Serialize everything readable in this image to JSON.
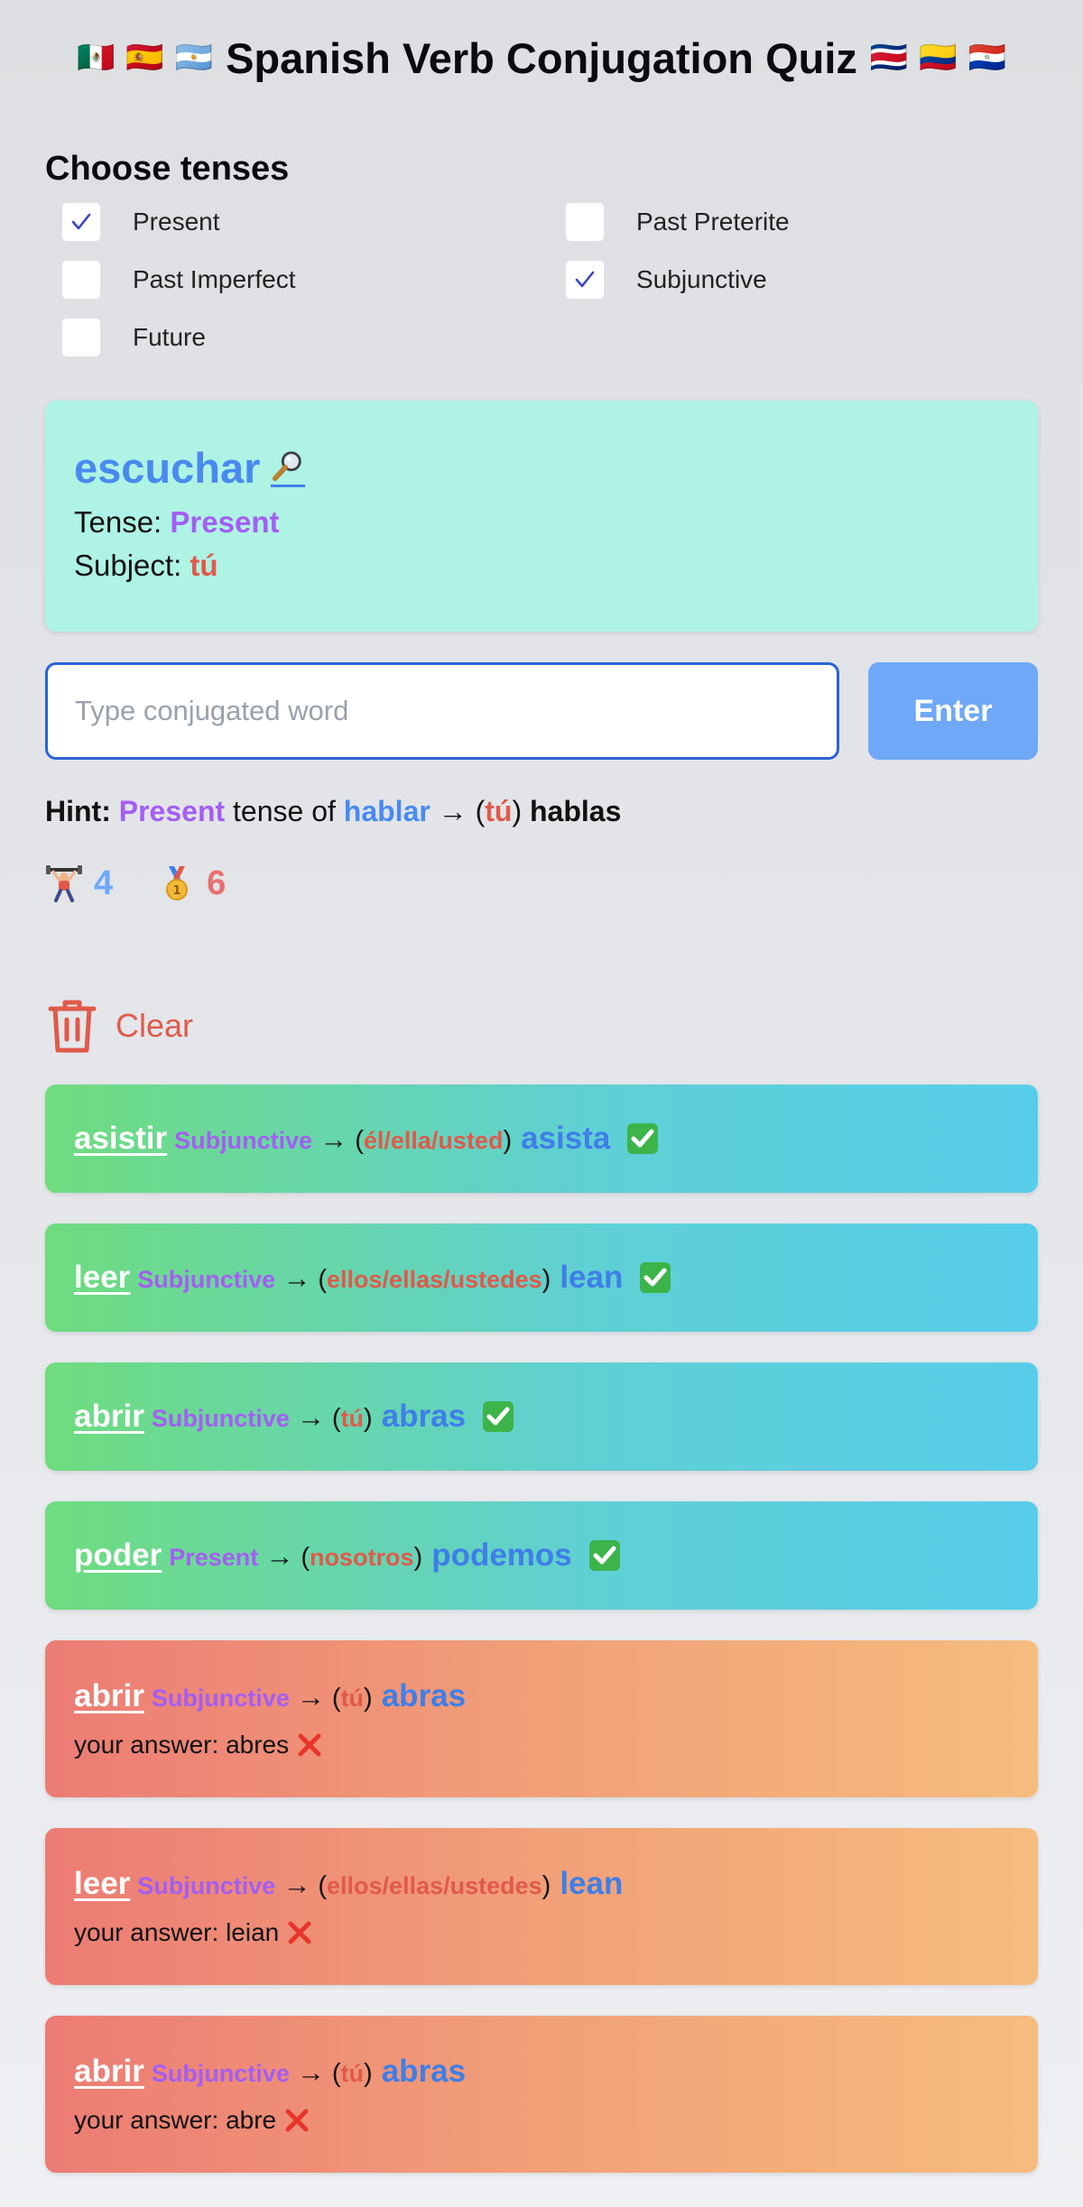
{
  "header": {
    "title": "Spanish Verb Conjugation Quiz",
    "flags_left": [
      "🇲🇽",
      "🇪🇸",
      "🇦🇷"
    ],
    "flags_right": [
      "🇨🇷",
      "🇨🇴",
      "🇵🇾"
    ]
  },
  "tenses": {
    "title": "Choose tenses",
    "options": [
      {
        "label": "Present",
        "checked": true
      },
      {
        "label": "Past Preterite",
        "checked": false
      },
      {
        "label": "Past Imperfect",
        "checked": false
      },
      {
        "label": "Subjunctive",
        "checked": true
      },
      {
        "label": "Future",
        "checked": false
      }
    ]
  },
  "prompt": {
    "verb": "escuchar",
    "tense_label": "Tense: ",
    "tense": "Present",
    "subject_label": "Subject: ",
    "subject": "tú"
  },
  "answer": {
    "placeholder": "Type conjugated word",
    "value": "",
    "enter_label": "Enter"
  },
  "hint": {
    "label": "Hint:",
    "tense": "Present",
    "middle": "tense of",
    "verb": "hablar",
    "arrow": "→",
    "subject": "tú",
    "answer": "hablas"
  },
  "stats": {
    "streak": "4",
    "medals": "6"
  },
  "clear_label": "Clear",
  "history_labels": {
    "your_answer_prefix": "your answer: "
  },
  "history": [
    {
      "verb": "asistir",
      "tense": "Subjunctive",
      "subject": "él/ella/usted",
      "answer": "asista",
      "correct": true
    },
    {
      "verb": "leer",
      "tense": "Subjunctive",
      "subject": "ellos/ellas/ustedes",
      "answer": "lean",
      "correct": true
    },
    {
      "verb": "abrir",
      "tense": "Subjunctive",
      "subject": "tú",
      "answer": "abras",
      "correct": true
    },
    {
      "verb": "poder",
      "tense": "Present",
      "subject": "nosotros",
      "answer": "podemos",
      "correct": true
    },
    {
      "verb": "abrir",
      "tense": "Subjunctive",
      "subject": "tú",
      "answer": "abras",
      "correct": false,
      "user_answer": "abres"
    },
    {
      "verb": "leer",
      "tense": "Subjunctive",
      "subject": "ellos/ellas/ustedes",
      "answer": "lean",
      "correct": false,
      "user_answer": "leian"
    },
    {
      "verb": "abrir",
      "tense": "Subjunctive",
      "subject": "tú",
      "answer": "abras",
      "correct": false,
      "user_answer": "abre"
    }
  ],
  "colors": {
    "accent_blue": "#4a8af0",
    "tense_purple": "#a45ef4",
    "subject_red": "#e05a4a",
    "card_mint": "#aef3e4",
    "button_blue": "#6ea8f6"
  }
}
